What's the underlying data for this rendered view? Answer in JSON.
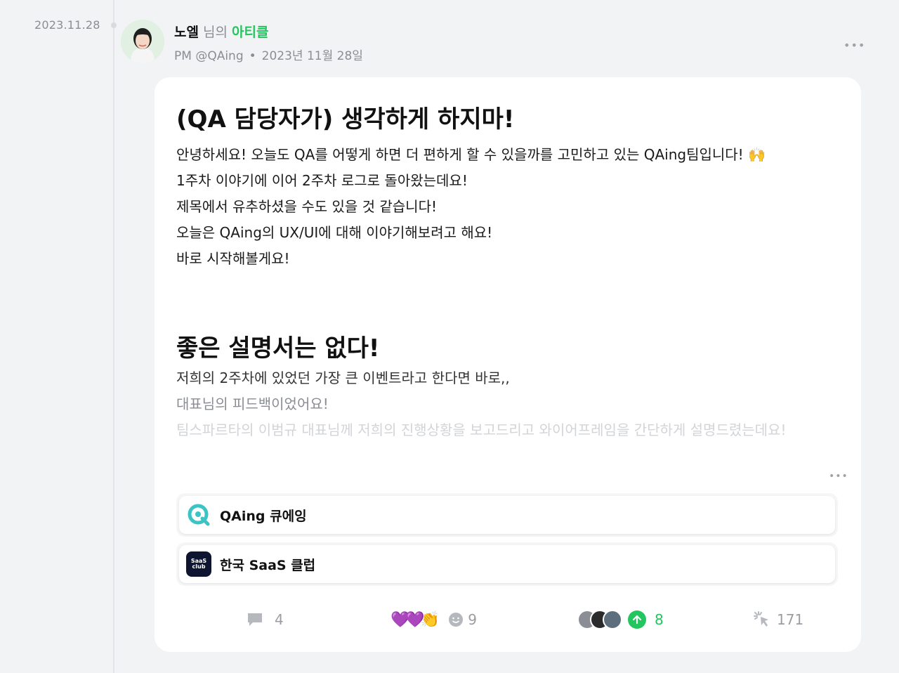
{
  "timeline": {
    "date": "2023.11.28"
  },
  "author": {
    "name": "노엘",
    "suffix": "님의",
    "post_type": "아티클",
    "role": "PM @QAing",
    "date": "2023년 11월 28일"
  },
  "post": {
    "title": "(QA 담당자가) 생각하게 하지마!",
    "intro": [
      "안녕하세요! 오늘도 QA를 어떻게 하면 더 편하게 할 수 있을까를 고민하고 있는 QAing팀입니다! 🙌",
      "1주차 이야기에 이어 2주차 로그로 돌아왔는데요!",
      "제목에서 유추하셨을 수도 있을 것 같습니다!",
      "오늘은 QAing의 UX/UI에 대해 이야기해보려고 해요!",
      "바로 시작해볼게요!"
    ],
    "subheading": "좋은 설명서는 없다!",
    "section": [
      "저희의 2주차에 있었던 가장 큰 이벤트라고 한다면 바로,,",
      "대표님의 피드백이었어요!",
      "팀스파르타의 이범규 대표님께 저희의 진행상황을 보고드리고 와이어프레임을 간단하게 설명드렸는데요!"
    ]
  },
  "tags": [
    {
      "label": "QAing 큐에잉",
      "icon": "qaing-logo"
    },
    {
      "label": "한국 SaaS 클럽",
      "icon": "saas-club-logo",
      "logo_text": "SaaS club"
    }
  ],
  "actions": {
    "comments": "4",
    "reaction_emojis": [
      "💜",
      "💜",
      "👏"
    ],
    "reactions": "9",
    "votes": "8",
    "views": "171"
  },
  "colors": {
    "accent_green": "#22c55e",
    "muted": "#8a8d93",
    "background": "#f2f3f5"
  }
}
